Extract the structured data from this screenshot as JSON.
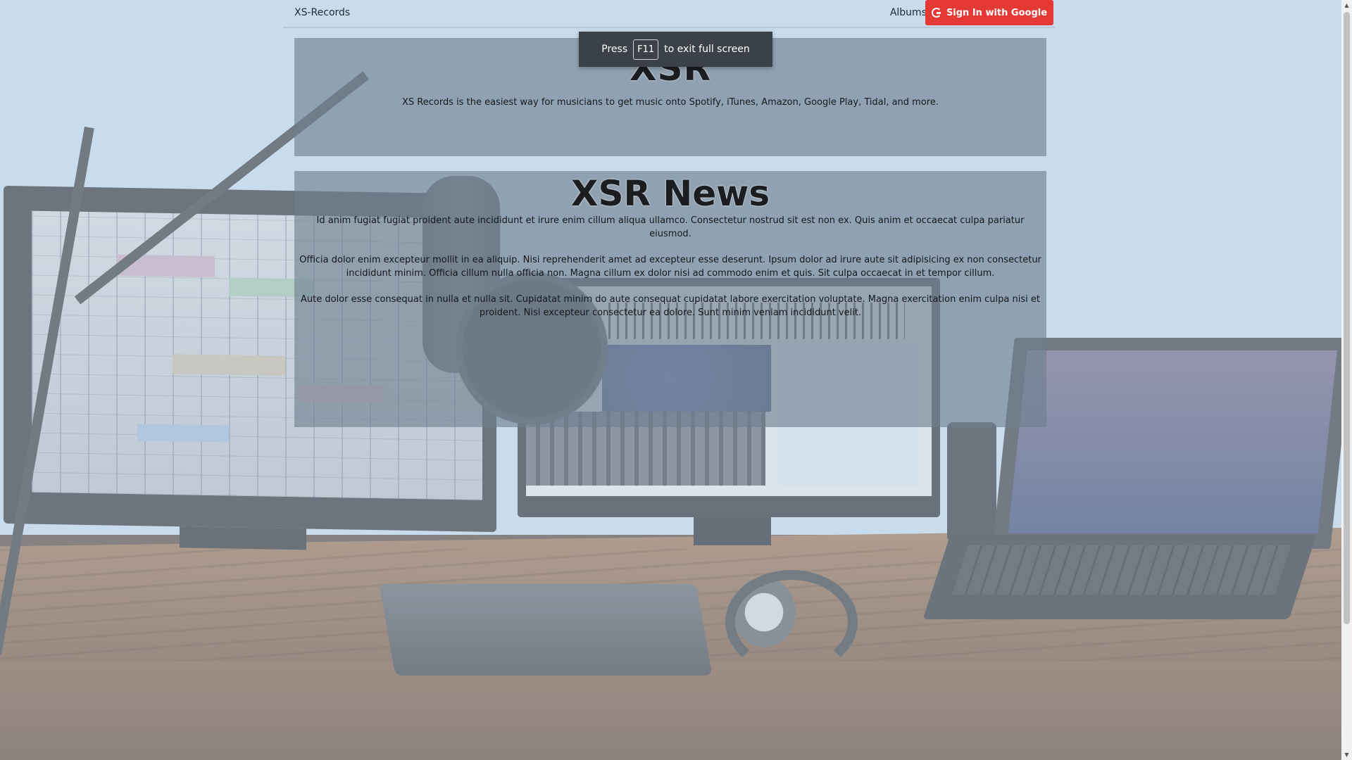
{
  "navbar": {
    "brand": "XS-Records",
    "albums_label": "Albums",
    "signin_label": "Sign In with Google"
  },
  "hero": {
    "title": "XSR",
    "subtitle": "XS Records is the easiest way for musicians to get music onto Spotify, iTunes, Amazon, Google Play, Tidal, and more."
  },
  "news": {
    "title": "XSR News",
    "paragraphs": [
      "Id anim fugiat fugiat proident aute incididunt et irure enim cillum aliqua ullamco. Consectetur nostrud sit est non ex. Quis anim et occaecat culpa pariatur eiusmod.",
      "Officia dolor enim excepteur mollit in ea aliquip. Nisi reprehenderit amet ad excepteur esse deserunt. Ipsum dolor ad irure aute sit adipisicing ex non consectetur incididunt minim. Officia cillum nulla officia non. Magna cillum ex dolor nisi ad commodo enim et quis. Sit culpa occaecat in et tempor cillum.",
      "Aute dolor esse consequat in nulla et nulla sit. Cupidatat minim do aute consequat cupidatat labore exercitation voluptate. Magna exercitation enim culpa nisi et proident. Nisi excepteur consectetur ea dolore. Sunt minim veniam incididunt velit."
    ]
  },
  "fullscreen_toast": {
    "prefix": "Press",
    "key": "F11",
    "suffix": "to exit full screen"
  },
  "colors": {
    "signin_button": "#e53935",
    "panel_overlay": "#6e7e8e",
    "page_background": "#c9dcec"
  },
  "icons": {
    "signin": "google-icon",
    "background": "studio-photo"
  }
}
